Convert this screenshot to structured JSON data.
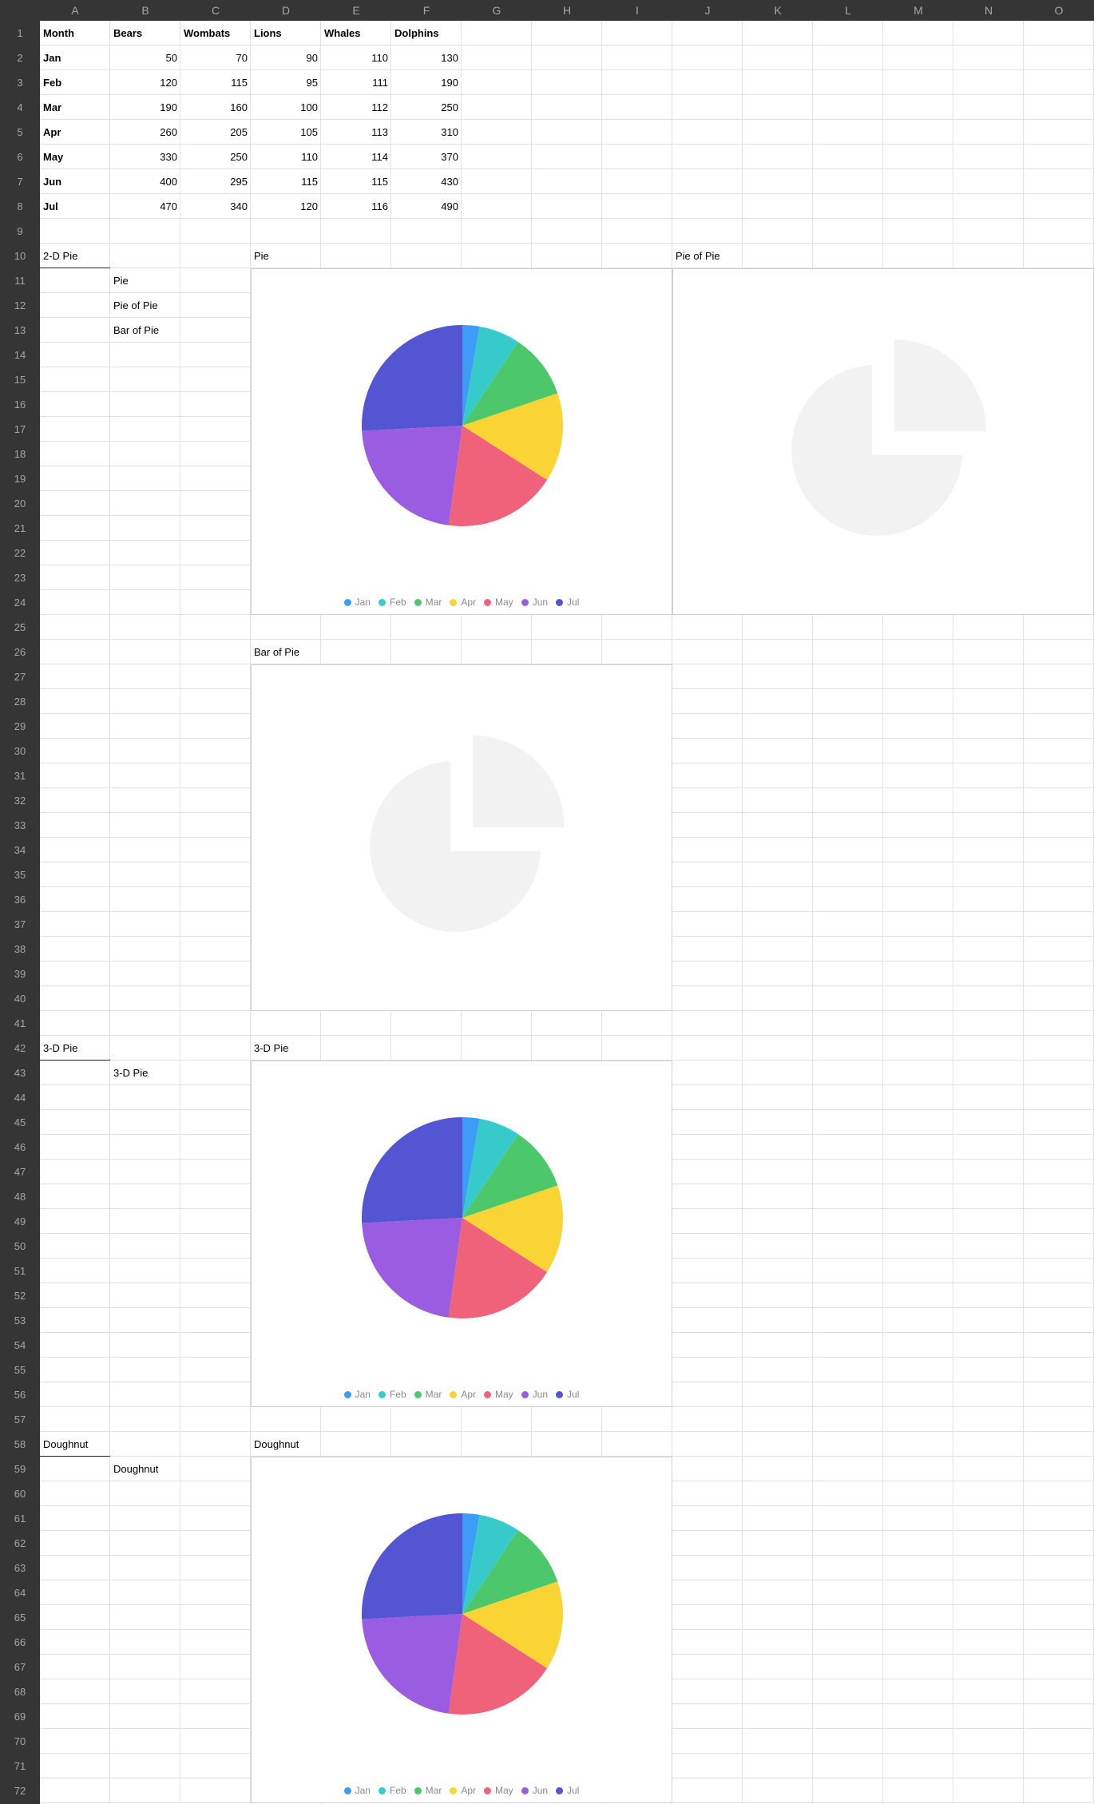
{
  "columns": [
    "A",
    "B",
    "C",
    "D",
    "E",
    "F",
    "G",
    "H",
    "I",
    "J",
    "K",
    "L",
    "M",
    "N",
    "O"
  ],
  "rows": [
    "1",
    "2",
    "3",
    "4",
    "5",
    "6",
    "7",
    "8",
    "9",
    "10",
    "11",
    "12",
    "13",
    "14",
    "15",
    "16",
    "17",
    "18",
    "19",
    "20",
    "21",
    "22",
    "23",
    "24",
    "25",
    "26",
    "27",
    "28",
    "29",
    "30",
    "31",
    "32",
    "33",
    "34",
    "35",
    "36",
    "37",
    "38",
    "39",
    "40",
    "41",
    "42",
    "43",
    "44",
    "45",
    "46",
    "47",
    "48",
    "49",
    "50",
    "51",
    "52",
    "53",
    "54",
    "55",
    "56",
    "57",
    "58",
    "59",
    "60",
    "61",
    "62",
    "63",
    "64",
    "65",
    "66",
    "67",
    "68",
    "69",
    "70",
    "71",
    "72"
  ],
  "table": {
    "headers": [
      "Month",
      "Bears",
      "Wombats",
      "Lions",
      "Whales",
      "Dolphins"
    ],
    "rows": [
      [
        "Jan",
        "50",
        "70",
        "90",
        "110",
        "130"
      ],
      [
        "Feb",
        "120",
        "115",
        "95",
        "111",
        "190"
      ],
      [
        "Mar",
        "190",
        "160",
        "100",
        "112",
        "250"
      ],
      [
        "Apr",
        "260",
        "205",
        "105",
        "113",
        "310"
      ],
      [
        "May",
        "330",
        "250",
        "110",
        "114",
        "370"
      ],
      [
        "Jun",
        "400",
        "295",
        "115",
        "115",
        "430"
      ],
      [
        "Jul",
        "470",
        "340",
        "120",
        "116",
        "490"
      ]
    ]
  },
  "labels": {
    "section_2d": "2-D Pie",
    "list_pie": "Pie",
    "list_pie_of_pie": "Pie of Pie",
    "list_bar_of_pie": "Bar of Pie",
    "chart_title_pie": "Pie",
    "chart_title_pie_of_pie": "Pie of Pie",
    "chart_title_bar_of_pie": "Bar of Pie",
    "section_3d": "3-D Pie",
    "list_3d_pie": "3-D Pie",
    "chart_title_3d_pie": "3-D Pie",
    "section_doughnut": "Doughnut",
    "list_doughnut": "Doughnut",
    "chart_title_doughnut": "Doughnut"
  },
  "colors": {
    "Jan": "#3d9df6",
    "Feb": "#36cbca",
    "Mar": "#4cc76c",
    "Apr": "#f9d434",
    "May": "#f0617a",
    "Jun": "#9a5ce0",
    "Jul": "#5355d2",
    "placeholder": "#f2f2f2",
    "header_bg": "#353535",
    "header_text": "#a6a6a6"
  },
  "chart_data": [
    {
      "type": "pie",
      "series_column": "Bears",
      "categories": [
        "Jan",
        "Feb",
        "Mar",
        "Apr",
        "May",
        "Jun",
        "Jul"
      ],
      "values": [
        50,
        120,
        190,
        260,
        330,
        400,
        470
      ],
      "legend": "bottom"
    },
    {
      "type": "pie",
      "series_column": "Bears",
      "categories": [
        "Jan",
        "Feb",
        "Mar",
        "Apr",
        "May",
        "Jun",
        "Jul"
      ],
      "values": [
        50,
        120,
        190,
        260,
        330,
        400,
        470
      ],
      "legend": "bottom"
    },
    {
      "type": "pie",
      "series_column": "Bears",
      "categories": [
        "Jan",
        "Feb",
        "Mar",
        "Apr",
        "May",
        "Jun",
        "Jul"
      ],
      "values": [
        50,
        120,
        190,
        260,
        330,
        400,
        470
      ],
      "legend": "bottom"
    }
  ]
}
